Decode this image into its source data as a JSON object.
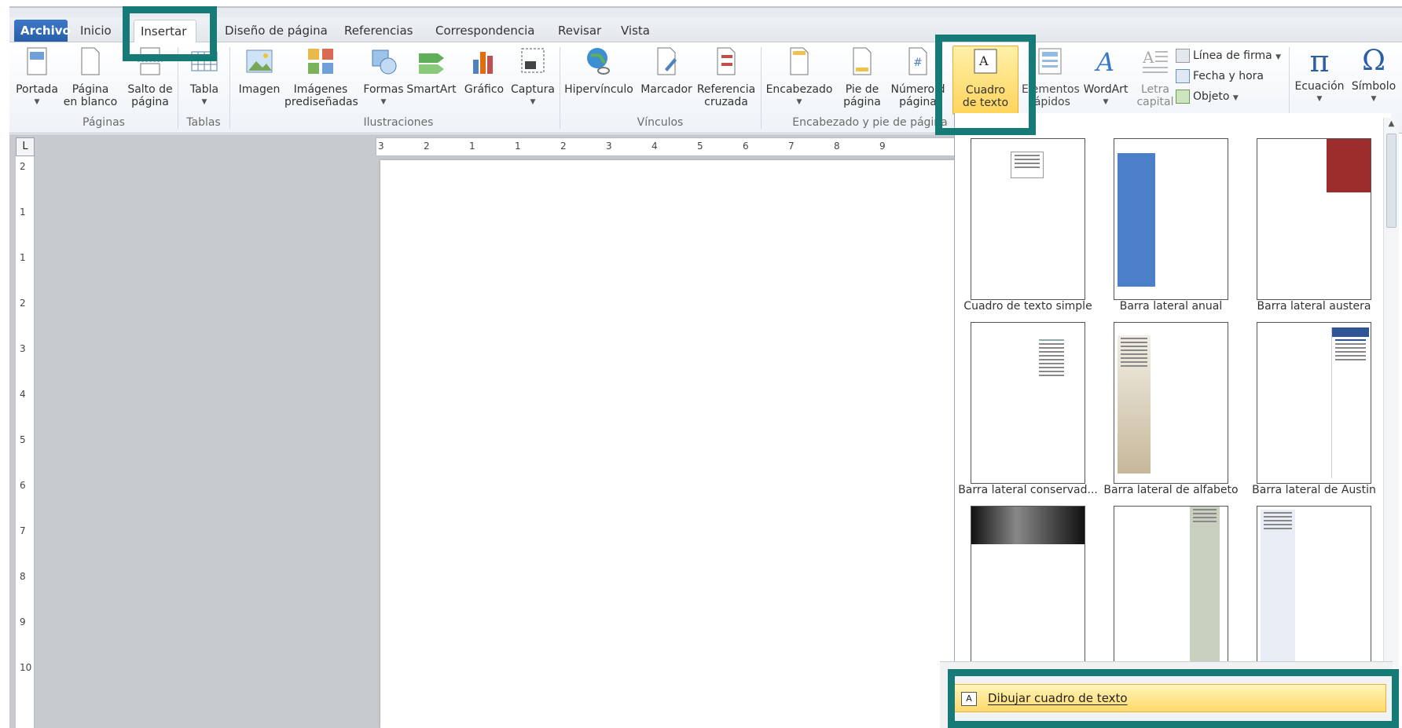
{
  "tabs": [
    {
      "label": "Archivo"
    },
    {
      "label": "Inicio"
    },
    {
      "label": "Insertar"
    },
    {
      "label": "Diseño de página"
    },
    {
      "label": "Referencias"
    },
    {
      "label": "Correspondencia"
    },
    {
      "label": "Revisar"
    },
    {
      "label": "Vista"
    }
  ],
  "ribbon": {
    "portada": "Portada",
    "pagina_blanco": [
      "Página",
      "en blanco"
    ],
    "salto_pagina": [
      "Salto de",
      "página"
    ],
    "tabla": "Tabla",
    "imagen": "Imagen",
    "imagenes_pred": [
      "Imágenes",
      "prediseñadas"
    ],
    "formas": "Formas",
    "smartart": "SmartArt",
    "grafico": "Gráfico",
    "captura": "Captura",
    "hipervinculo": "Hipervínculo",
    "marcador": "Marcador",
    "referencia": [
      "Referencia",
      "cruzada"
    ],
    "encabezado": "Encabezado",
    "pie": [
      "Pie de",
      "página"
    ],
    "numero": [
      "Número d",
      "página"
    ],
    "cuadro": [
      "Cuadro",
      "de texto"
    ],
    "elementos": [
      "Elementos",
      "rápidos"
    ],
    "wordart": "WordArt",
    "letra": [
      "Letra",
      "capital"
    ],
    "linea_firma": "Línea de firma",
    "fecha_hora": "Fecha y hora",
    "objeto": "Objeto",
    "ecuacion": "Ecuación",
    "simbolo": "Símbolo"
  },
  "groups": {
    "paginas": "Páginas",
    "tablas": "Tablas",
    "ilustraciones": "Ilustraciones",
    "vinculos": "Vínculos",
    "encabezado_pie": "Encabezado y pie de página"
  },
  "gallery": [
    {
      "label": "Cuadro de texto simple"
    },
    {
      "label": "Barra lateral anual"
    },
    {
      "label": "Barra lateral austera"
    },
    {
      "label": "Barra lateral conservad..."
    },
    {
      "label": "Barra lateral de alfabeto"
    },
    {
      "label": "Barra lateral de Austin"
    }
  ],
  "menu": {
    "draw": "Dibujar cuadro de texto"
  },
  "ruler": {
    "h_ticks": [
      "3",
      "2",
      "1",
      "1",
      "2",
      "3",
      "4",
      "5",
      "6",
      "7",
      "8",
      "9"
    ],
    "v_ticks": [
      "2",
      "1",
      "1",
      "2",
      "3",
      "4",
      "5",
      "6",
      "7",
      "8",
      "9",
      "10"
    ]
  },
  "colors": {
    "file_tab": "#2f66b3",
    "highlight": "#167a76",
    "selected": "#ffd96a"
  }
}
